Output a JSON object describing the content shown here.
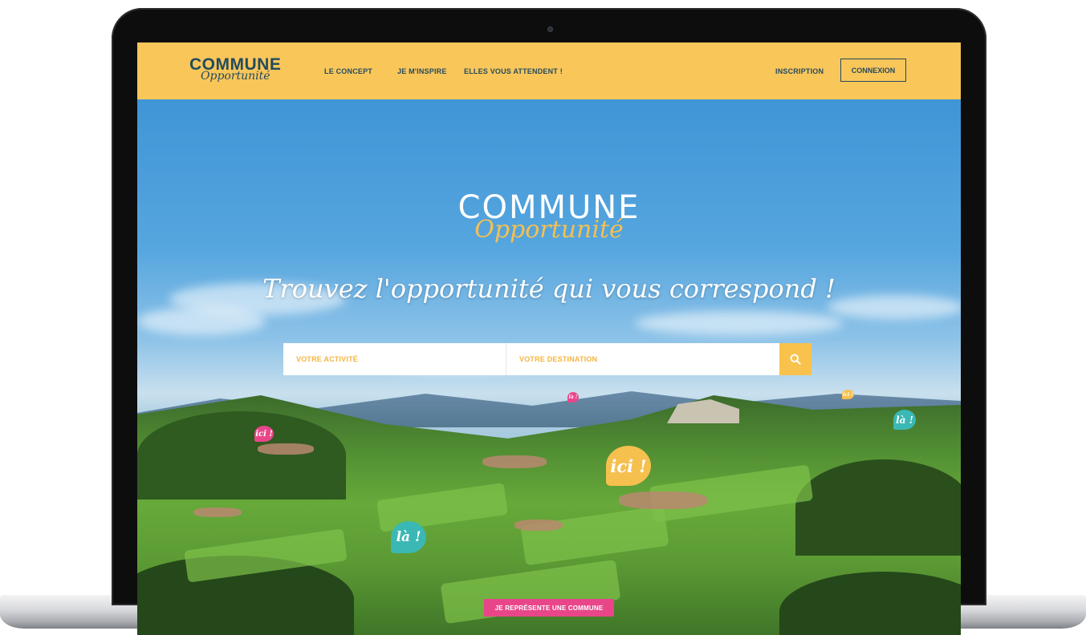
{
  "nav": {
    "logo_main": "COMMUNE",
    "logo_script": "Opportunité",
    "links": [
      "LE CONCEPT",
      "JE M'INSPIRE",
      "ELLES VOUS ATTENDENT !"
    ],
    "inscription": "INSCRIPTION",
    "connexion": "CONNEXION"
  },
  "hero": {
    "logo_main": "COMMUNE",
    "logo_script": "Opportunité",
    "tagline": "Trouvez l'opportunité qui vous correspond !",
    "search": {
      "activity_placeholder": "VOTRE ACTIVITÉ",
      "destination_placeholder": "VOTRE DESTINATION",
      "button_icon": "search-icon"
    },
    "bubbles": [
      "ici !",
      "là !",
      "ici !",
      "là !",
      "ici !",
      "là !"
    ],
    "cta": "JE REPRÉSENTE UNE COMMUNE"
  },
  "colors": {
    "nav_bg": "#f9c65a",
    "nav_text": "#244b5e",
    "accent_yellow": "#f9c24c",
    "accent_pink": "#e9468a",
    "accent_teal": "#3bb8b4"
  }
}
